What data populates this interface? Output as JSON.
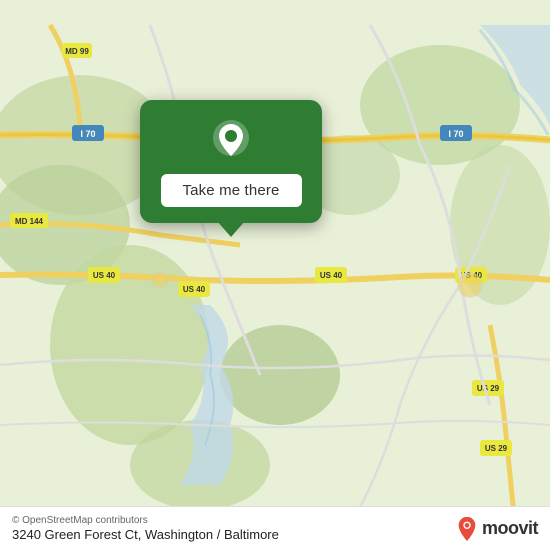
{
  "map": {
    "background_color": "#e8f0d8",
    "alt": "Map of Washington/Baltimore area"
  },
  "popup": {
    "button_label": "Take me there",
    "background_color": "#2e7d32"
  },
  "bottom_bar": {
    "copyright": "© OpenStreetMap contributors",
    "address": "3240 Green Forest Ct, Washington / Baltimore",
    "logo_text": "moovit"
  }
}
